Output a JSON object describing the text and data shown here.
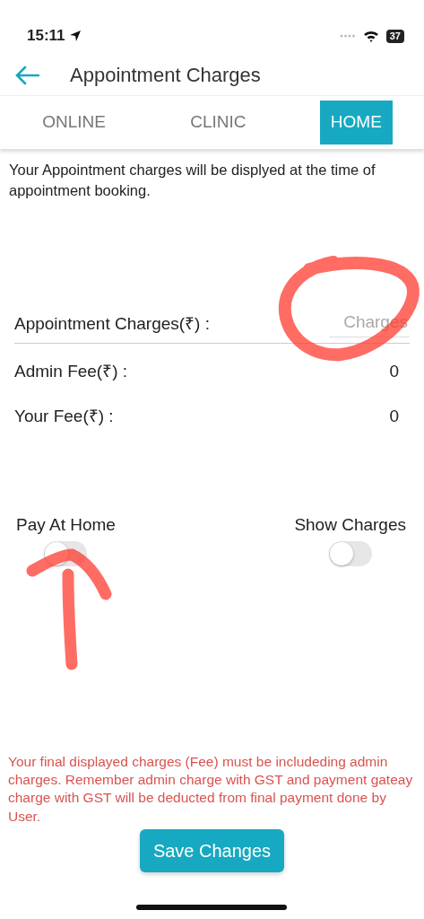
{
  "status_bar": {
    "time": "15:11",
    "battery": "37"
  },
  "header": {
    "title": "Appointment Charges"
  },
  "tabs": [
    {
      "label": "ONLINE",
      "selected": false
    },
    {
      "label": "CLINIC",
      "selected": false
    },
    {
      "label": "HOME",
      "selected": true
    }
  ],
  "info": "Your Appointment charges will be displyed at the time of appointment booking.",
  "charges_field": {
    "label": "Appointment Charges(₹) :",
    "placeholder": "Charges"
  },
  "fees": [
    {
      "label": "Admin Fee(₹) :",
      "value": "0"
    },
    {
      "label": "Your Fee(₹) :",
      "value": "0"
    }
  ],
  "toggles": [
    {
      "label": "Pay At Home",
      "on": false
    },
    {
      "label": "Show Charges",
      "on": false
    }
  ],
  "warning": "Your final displayed charges (Fee) must be includeding admin charges. Remember admin charge with GST and payment gateay charge with GST will be deducted from final payment done by User.",
  "save_button": "Save Changes"
}
